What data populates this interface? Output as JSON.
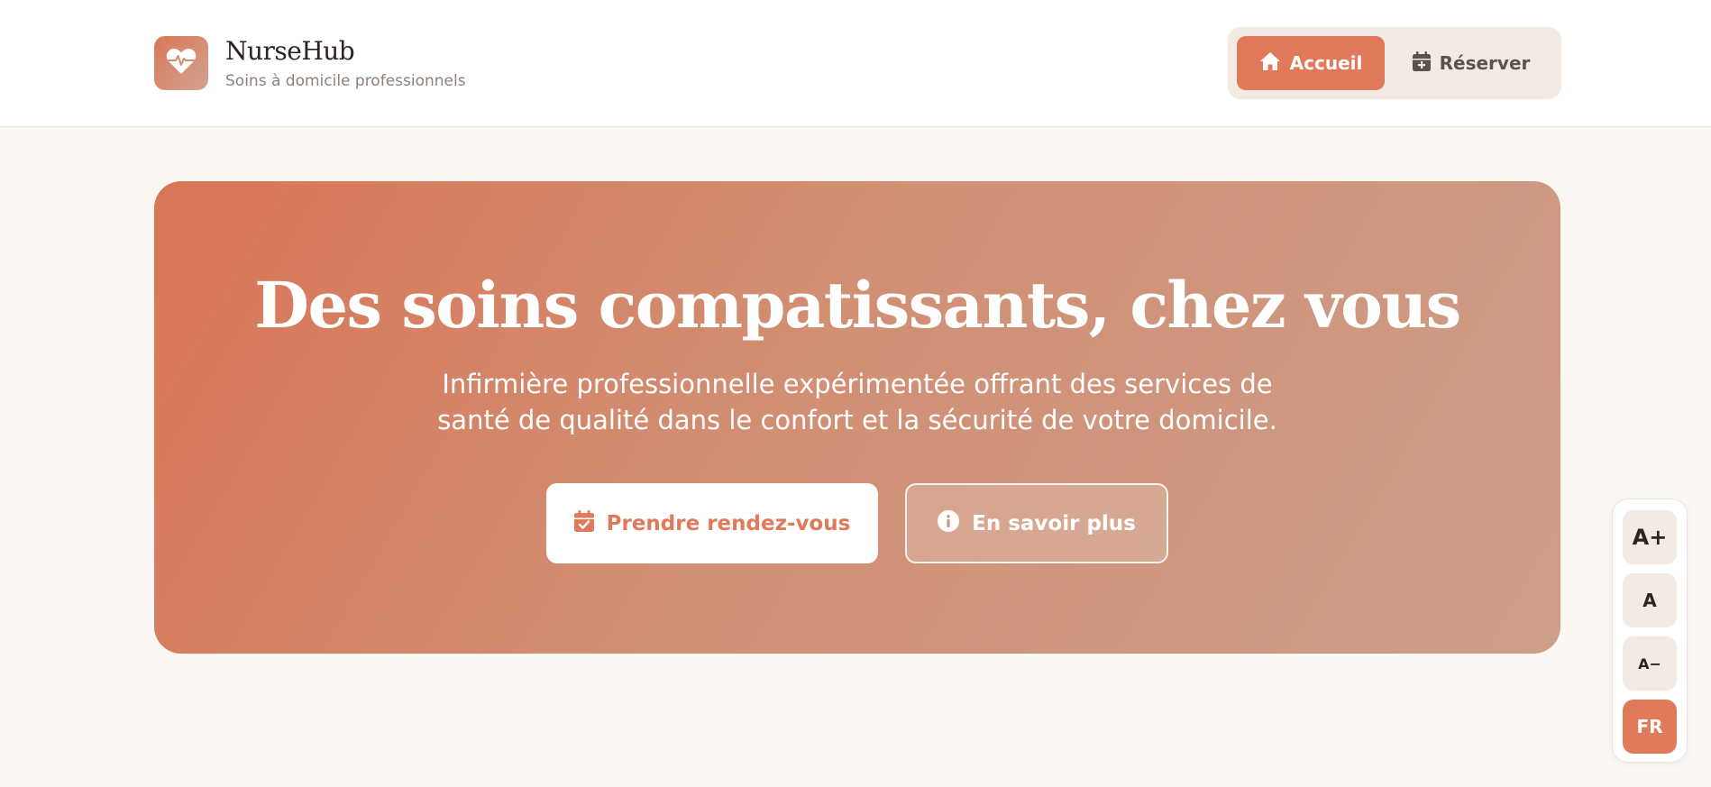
{
  "colors": {
    "accent": "#e07a5a",
    "background": "#fbf7f2",
    "nav_bg": "#f3ebe3",
    "hero_gradient_start": "#d97556",
    "hero_gradient_end": "#cc9e89"
  },
  "header": {
    "brand_name": "NurseHub",
    "brand_subtitle": "Soins à domicile professionnels",
    "logo_icon": "heart-pulse-icon",
    "nav": [
      {
        "label": "Accueil",
        "icon": "home-icon",
        "active": true
      },
      {
        "label": "Réserver",
        "icon": "calendar-plus-icon",
        "active": false
      }
    ]
  },
  "hero": {
    "title": "Des soins compatissants, chez vous",
    "description_line1": "Infirmière professionnelle expérimentée offrant des services de",
    "description_line2": "santé de qualité dans le confort et la sécurité de votre domicile.",
    "primary_button": {
      "label": "Prendre rendez-vous",
      "icon": "calendar-check-icon"
    },
    "secondary_button": {
      "label": "En savoir plus",
      "icon": "info-circle-icon"
    }
  },
  "accessibility": {
    "increase_label": "A+",
    "normal_label": "A",
    "decrease_label": "A−",
    "language_label": "FR"
  }
}
